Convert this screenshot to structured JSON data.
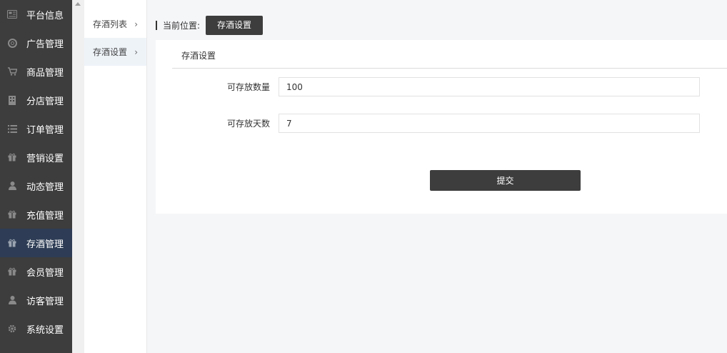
{
  "sidebar": {
    "items": [
      {
        "label": "平台信息",
        "icon": "newspaper-icon",
        "active": false
      },
      {
        "label": "广告管理",
        "icon": "lifebuoy-icon",
        "active": false
      },
      {
        "label": "商品管理",
        "icon": "cart-icon",
        "active": false
      },
      {
        "label": "分店管理",
        "icon": "building-icon",
        "active": false
      },
      {
        "label": "订单管理",
        "icon": "list-icon",
        "active": false
      },
      {
        "label": "营销设置",
        "icon": "gift-icon",
        "active": false
      },
      {
        "label": "动态管理",
        "icon": "user-icon",
        "active": false
      },
      {
        "label": "充值管理",
        "icon": "gift-icon",
        "active": false
      },
      {
        "label": "存酒管理",
        "icon": "gift-icon",
        "active": true
      },
      {
        "label": "会员管理",
        "icon": "gift-icon",
        "active": false
      },
      {
        "label": "访客管理",
        "icon": "user-icon",
        "active": false
      },
      {
        "label": "系统设置",
        "icon": "gear-icon",
        "active": false
      }
    ]
  },
  "submenu": {
    "items": [
      {
        "label": "存酒列表",
        "active": false
      },
      {
        "label": "存酒设置",
        "active": true
      }
    ]
  },
  "breadcrumb": {
    "prefix": "当前位置:",
    "current": "存酒设置"
  },
  "panel": {
    "title": "存酒设置"
  },
  "form": {
    "max_count_label": "可存放数量",
    "max_count_value": "100",
    "max_days_label": "可存放天数",
    "max_days_value": "7",
    "submit_label": "提交"
  },
  "colors": {
    "sidebar_bg": "#3d3d3d",
    "sidebar_active": "#2e3d55",
    "button_bg": "#3d3d3d"
  }
}
